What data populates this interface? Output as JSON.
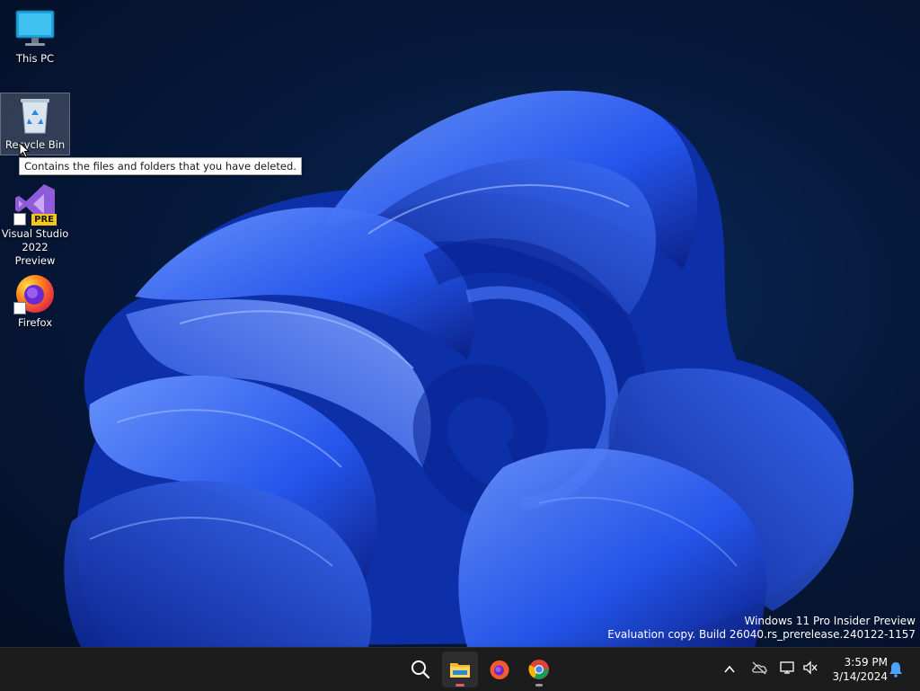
{
  "desktop": {
    "icons": [
      {
        "label": "This PC",
        "icon": "monitor-icon"
      },
      {
        "label": "Recycle Bin",
        "icon": "recycle-bin-icon"
      },
      {
        "label": "Visual Studio 2022 Preview",
        "icon": "visual-studio-preview-icon",
        "badge": "PRE"
      },
      {
        "label": "Firefox",
        "icon": "firefox-icon"
      }
    ],
    "tooltip": "Contains the files and folders that you have deleted.",
    "watermark": {
      "line1": "Windows 11 Pro Insider Preview",
      "line2": "Evaluation copy. Build 26040.rs_prerelease.240122-1157"
    }
  },
  "taskbar": {
    "apps": [
      {
        "name": "Search",
        "icon": "search-icon"
      },
      {
        "name": "File Explorer",
        "icon": "file-explorer-icon",
        "active": true
      },
      {
        "name": "Firefox",
        "icon": "firefox-icon"
      },
      {
        "name": "Google Chrome",
        "icon": "chrome-icon"
      }
    ],
    "tray": [
      "chevron-up-icon",
      "onedrive-icon",
      "network-icon",
      "volume-muted-icon"
    ],
    "clock": {
      "time": "3:59 PM",
      "date": "3/14/2024"
    },
    "notification": "bell-icon"
  },
  "colors": {
    "taskbar_bg": "#1c1c1c",
    "accent_running": "#e05a6a",
    "wallpaper_blue": "#1f4fe0"
  }
}
